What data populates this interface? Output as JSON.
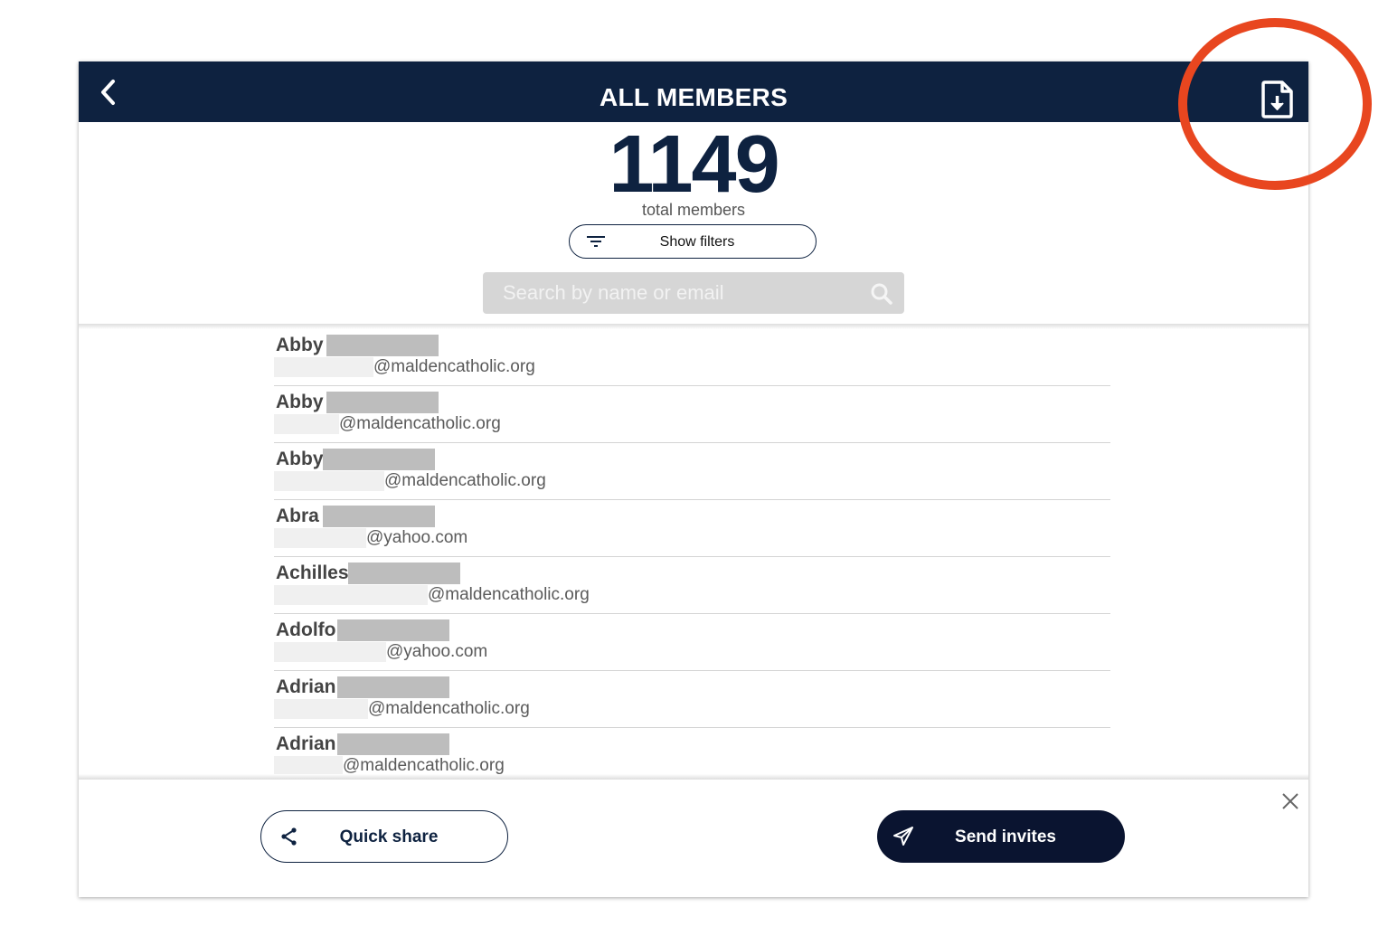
{
  "header": {
    "title": "ALL MEMBERS"
  },
  "summary": {
    "count": "1149",
    "count_label": "total members"
  },
  "filters": {
    "label": "Show filters"
  },
  "search": {
    "placeholder": "Search by name or email"
  },
  "members": [
    {
      "name": "Abby",
      "email": "@maldencatholic.org"
    },
    {
      "name": "Abby",
      "email": "@maldencatholic.org"
    },
    {
      "name": "Abby",
      "email": "@maldencatholic.org"
    },
    {
      "name": "Abra",
      "email": "@yahoo.com"
    },
    {
      "name": "Achilles",
      "email": "@maldencatholic.org"
    },
    {
      "name": "Adolfo",
      "email": "@yahoo.com"
    },
    {
      "name": "Adrian",
      "email": "@maldencatholic.org"
    },
    {
      "name": "Adrian",
      "email": "@maldencatholic.org"
    }
  ],
  "footer": {
    "quick_share_label": "Quick share",
    "send_invites_label": "Send invites"
  },
  "colors": {
    "header_bg": "#0e2240",
    "highlight": "#e8461f",
    "primary_button": "#0a1430"
  },
  "icons": {
    "back": "chevron-left-icon",
    "export": "file-download-icon",
    "filter": "filter-lines-icon",
    "search": "magnifier-icon",
    "close": "close-icon",
    "share": "share-icon",
    "send": "paper-plane-icon"
  }
}
